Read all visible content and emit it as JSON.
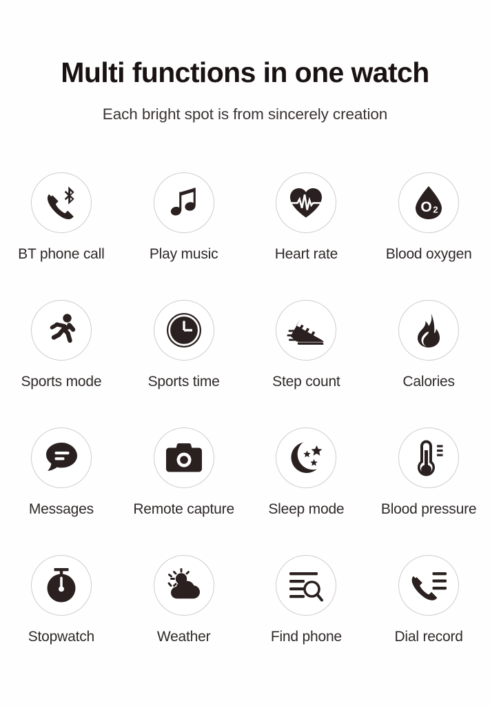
{
  "header": {
    "title": "Multi functions in one watch",
    "subtitle": "Each bright spot is from sincerely creation"
  },
  "colors": {
    "background": "#fefefe",
    "icon": "#2b2020",
    "circle_border": "#cfcccb",
    "title": "#1a1212",
    "label": "#2f2828"
  },
  "features": {
    "rows": [
      [
        {
          "label": "BT phone call",
          "icon": "bluetooth-phone-icon"
        },
        {
          "label": "Play music",
          "icon": "music-note-icon"
        },
        {
          "label": "Heart rate",
          "icon": "heart-pulse-icon"
        },
        {
          "label": "Blood oxygen",
          "icon": "oxygen-droplet-icon",
          "icon_text": "O",
          "icon_subscript": "2"
        }
      ],
      [
        {
          "label": "Sports mode",
          "icon": "running-person-icon"
        },
        {
          "label": "Sports time",
          "icon": "clock-icon"
        },
        {
          "label": "Step count",
          "icon": "running-shoe-icon"
        },
        {
          "label": "Calories",
          "icon": "flame-icon"
        }
      ],
      [
        {
          "label": "Messages",
          "icon": "speech-bubble-icon"
        },
        {
          "label": "Remote capture",
          "icon": "camera-icon"
        },
        {
          "label": "Sleep mode",
          "icon": "moon-stars-icon"
        },
        {
          "label": "Blood pressure",
          "icon": "thermometer-icon"
        }
      ],
      [
        {
          "label": "Stopwatch",
          "icon": "stopwatch-icon"
        },
        {
          "label": "Weather",
          "icon": "sun-cloud-icon"
        },
        {
          "label": "Find phone",
          "icon": "search-list-icon"
        },
        {
          "label": "Dial record",
          "icon": "call-log-icon"
        }
      ]
    ]
  }
}
